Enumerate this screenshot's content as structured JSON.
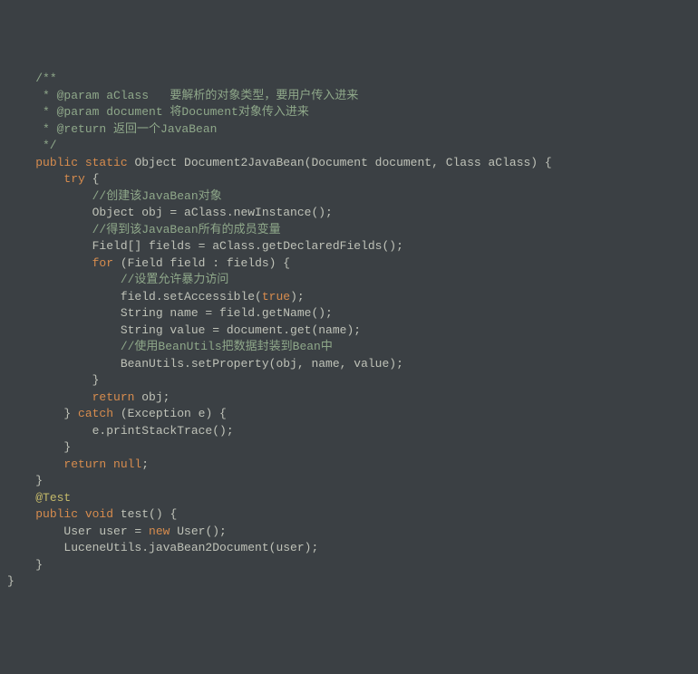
{
  "lines": [
    {
      "segs": [
        {
          "t": "    ",
          "c": ""
        },
        {
          "t": "/**",
          "c": "c-comment"
        }
      ]
    },
    {
      "segs": [
        {
          "t": "     * @param aClass   要解析的对象类型，要用户传入进来",
          "c": "c-comment"
        }
      ]
    },
    {
      "segs": [
        {
          "t": "     * @param document 将Document对象传入进来",
          "c": "c-comment"
        }
      ]
    },
    {
      "segs": [
        {
          "t": "     * @return 返回一个JavaBean",
          "c": "c-comment"
        }
      ]
    },
    {
      "segs": [
        {
          "t": "     */",
          "c": "c-comment"
        }
      ]
    },
    {
      "segs": [
        {
          "t": "    ",
          "c": ""
        },
        {
          "t": "public static ",
          "c": "c-keyword"
        },
        {
          "t": "Object Document2JavaBean(Document document, Class aClass) {",
          "c": ""
        }
      ]
    },
    {
      "segs": [
        {
          "t": "        ",
          "c": ""
        },
        {
          "t": "try ",
          "c": "c-keyword"
        },
        {
          "t": "{",
          "c": ""
        }
      ]
    },
    {
      "segs": [
        {
          "t": "            ",
          "c": ""
        },
        {
          "t": "//创建该JavaBean对象",
          "c": "c-comment"
        }
      ]
    },
    {
      "segs": [
        {
          "t": "            Object obj = aClass.newInstance();",
          "c": ""
        }
      ]
    },
    {
      "segs": [
        {
          "t": "            ",
          "c": ""
        },
        {
          "t": "//得到该JavaBean所有的成员变量",
          "c": "c-comment"
        }
      ]
    },
    {
      "segs": [
        {
          "t": "            Field[] fields = aClass.getDeclaredFields();",
          "c": ""
        }
      ]
    },
    {
      "segs": [
        {
          "t": "            ",
          "c": ""
        },
        {
          "t": "for ",
          "c": "c-keyword"
        },
        {
          "t": "(Field field : fields) {",
          "c": ""
        }
      ]
    },
    {
      "segs": [
        {
          "t": "",
          "c": ""
        }
      ]
    },
    {
      "segs": [
        {
          "t": "                ",
          "c": ""
        },
        {
          "t": "//设置允许暴力访问",
          "c": "c-comment"
        }
      ]
    },
    {
      "segs": [
        {
          "t": "                field.setAccessible(",
          "c": ""
        },
        {
          "t": "true",
          "c": "c-keyword"
        },
        {
          "t": ");",
          "c": ""
        }
      ]
    },
    {
      "segs": [
        {
          "t": "                String name = field.getName();",
          "c": ""
        }
      ]
    },
    {
      "segs": [
        {
          "t": "                String value = document.get(name);",
          "c": ""
        }
      ]
    },
    {
      "segs": [
        {
          "t": "                ",
          "c": ""
        },
        {
          "t": "//使用BeanUtils把数据封装到Bean中",
          "c": "c-comment"
        }
      ]
    },
    {
      "segs": [
        {
          "t": "                BeanUtils.setProperty(obj, name, value);",
          "c": ""
        }
      ]
    },
    {
      "segs": [
        {
          "t": "            }",
          "c": ""
        }
      ]
    },
    {
      "segs": [
        {
          "t": "            ",
          "c": ""
        },
        {
          "t": "return ",
          "c": "c-keyword"
        },
        {
          "t": "obj;",
          "c": ""
        }
      ]
    },
    {
      "segs": [
        {
          "t": "        } ",
          "c": ""
        },
        {
          "t": "catch ",
          "c": "c-keyword"
        },
        {
          "t": "(Exception e) {",
          "c": ""
        }
      ]
    },
    {
      "segs": [
        {
          "t": "            e.printStackTrace();",
          "c": ""
        }
      ]
    },
    {
      "segs": [
        {
          "t": "        }",
          "c": ""
        }
      ]
    },
    {
      "segs": [
        {
          "t": "        ",
          "c": ""
        },
        {
          "t": "return null",
          "c": "c-keyword"
        },
        {
          "t": ";",
          "c": ""
        }
      ]
    },
    {
      "segs": [
        {
          "t": "    }",
          "c": ""
        }
      ]
    },
    {
      "segs": [
        {
          "t": "    ",
          "c": ""
        },
        {
          "t": "@Test",
          "c": "c-annotation"
        }
      ]
    },
    {
      "segs": [
        {
          "t": "    ",
          "c": ""
        },
        {
          "t": "public void ",
          "c": "c-keyword"
        },
        {
          "t": "test() {",
          "c": ""
        }
      ]
    },
    {
      "segs": [
        {
          "t": "        User user = ",
          "c": ""
        },
        {
          "t": "new ",
          "c": "c-keyword"
        },
        {
          "t": "User();",
          "c": ""
        }
      ]
    },
    {
      "segs": [
        {
          "t": "        LuceneUtils.javaBean2Document(user);",
          "c": ""
        }
      ]
    },
    {
      "segs": [
        {
          "t": "    }",
          "c": ""
        }
      ]
    },
    {
      "segs": [
        {
          "t": "",
          "c": ""
        }
      ]
    },
    {
      "segs": [
        {
          "t": "}",
          "c": ""
        }
      ]
    }
  ]
}
